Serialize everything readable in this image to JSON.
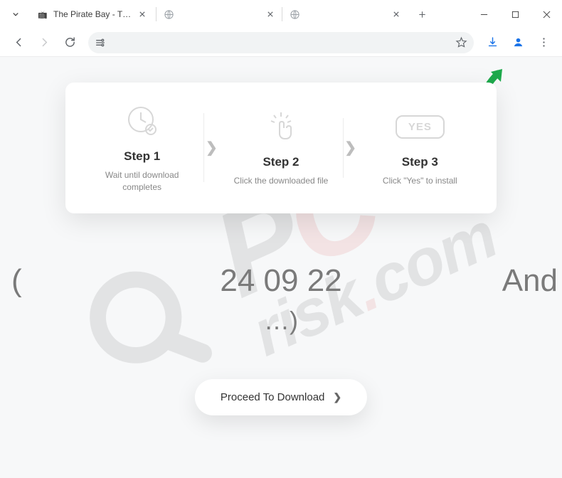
{
  "titlebar": {
    "tabs": [
      {
        "title": "The Pirate Bay - The galax",
        "favicon": "📺"
      },
      {
        "title": "",
        "favicon": "globe"
      },
      {
        "title": "",
        "favicon": "globe"
      }
    ]
  },
  "page": {
    "steps": [
      {
        "title": "Step 1",
        "desc": "Wait until download completes"
      },
      {
        "title": "Step 2",
        "desc": "Click the downloaded file"
      },
      {
        "title": "Step 3",
        "desc": "Click \"Yes\" to install",
        "yes": "YES"
      }
    ],
    "marquee_left": "(",
    "marquee_center": "24 09 22",
    "marquee_right": "And",
    "marquee_tail": "…)",
    "proceed": "Proceed To Download"
  },
  "watermark": {
    "pc_p": "P",
    "pc_c": "C",
    "risk": "risk",
    "dot": ".",
    "com": "com"
  }
}
